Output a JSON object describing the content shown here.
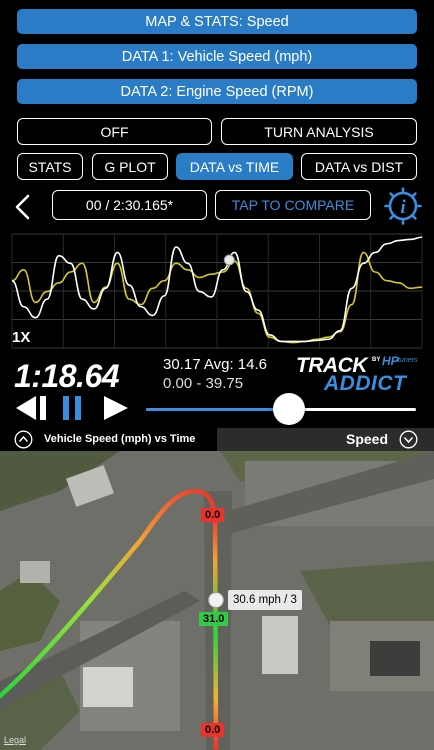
{
  "menu": {
    "map_stats": "MAP & STATS: Speed",
    "data1": "DATA 1: Vehicle Speed (mph)",
    "data2": "DATA 2: Engine Speed (RPM)"
  },
  "modes": {
    "off": "OFF",
    "turn_analysis": "TURN ANALYSIS"
  },
  "tabs": [
    {
      "label": "STATS",
      "active": false
    },
    {
      "label": "G PLOT",
      "active": false
    },
    {
      "label": "DATA vs TIME",
      "active": true
    },
    {
      "label": "DATA vs DIST",
      "active": false
    }
  ],
  "toolbar": {
    "back_icon": "chevron-left-icon",
    "lap_time": "00 / 2:30.165*",
    "compare": "TAP TO COMPARE",
    "info_icon": "info-gear-icon"
  },
  "graph": {
    "zoom": "1X",
    "series": [
      {
        "color": "#ffffff",
        "values": [
          0.62,
          0.38,
          0.28,
          0.45,
          0.85,
          0.78,
          0.45,
          0.36,
          0.55,
          0.88,
          0.58,
          0.38,
          0.3,
          0.48,
          0.93,
          0.78,
          0.52,
          0.47,
          0.72,
          0.88,
          0.52,
          0.35,
          0.12,
          0.06,
          0.06,
          0.06,
          0.07,
          0.08,
          0.16,
          0.55,
          0.78,
          0.88,
          0.96,
          0.99,
          1.0,
          1.02
        ]
      },
      {
        "color": "#d8c922",
        "values": [
          0.62,
          0.72,
          0.42,
          0.52,
          0.6,
          0.7,
          0.78,
          0.42,
          0.56,
          0.78,
          0.45,
          0.4,
          0.55,
          0.62,
          0.78,
          0.72,
          0.65,
          0.68,
          0.7,
          0.8,
          0.55,
          0.32,
          0.1,
          0.06,
          0.05,
          0.06,
          0.08,
          0.1,
          0.15,
          0.4,
          0.88,
          0.7,
          0.62,
          0.6,
          0.55,
          0.56
        ]
      }
    ],
    "cursor_fraction": 0.53
  },
  "playback": {
    "time": "1:18.64",
    "stat_line1": "30.17  Avg: 14.6",
    "stat_line2": "0.00 - 39.75",
    "progress": 0.53,
    "logo_track": "TRACK",
    "logo_addict": "ADDICT",
    "logo_by": "BY",
    "logo_hp": "HP",
    "logo_tuners": "tuners"
  },
  "label_bar": {
    "left_label": "Vehicle Speed (mph) vs Time",
    "right_label": "Speed",
    "left_icon": "chevron-up-circle-icon",
    "right_icon": "chevron-down-circle-icon"
  },
  "map": {
    "tags": [
      {
        "label": "0.0",
        "color": "#e8342c"
      },
      {
        "label": "31.0",
        "color": "#35c94a"
      },
      {
        "label": "0.0",
        "color": "#e8342c"
      }
    ],
    "callout": "30.6 mph / 3",
    "legal": "Legal"
  }
}
